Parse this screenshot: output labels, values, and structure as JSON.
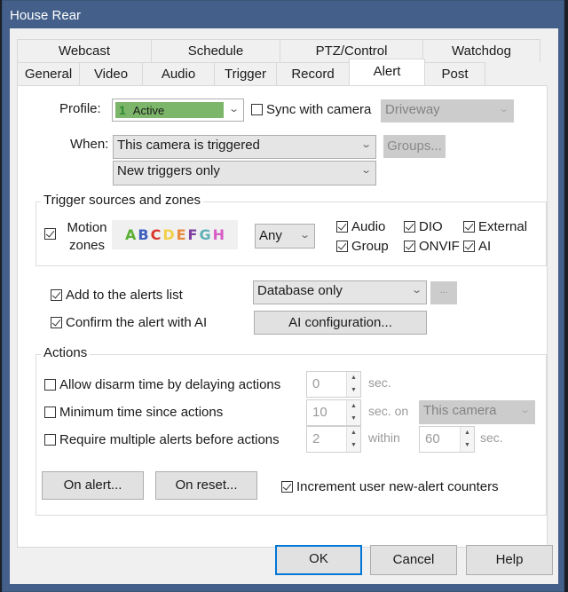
{
  "window": {
    "title": "House Rear"
  },
  "tabs": {
    "row1": [
      "Webcast",
      "Schedule",
      "PTZ/Control",
      "Watchdog"
    ],
    "row2": [
      "General",
      "Video",
      "Audio",
      "Trigger",
      "Record",
      "Alert",
      "Post"
    ],
    "active": "Alert"
  },
  "profile": {
    "label": "Profile:",
    "number": "1",
    "value": "Active",
    "color": "#7cb66a",
    "sync_label": "Sync with camera",
    "sync_checked": false,
    "sync_camera": "Driveway"
  },
  "when": {
    "label": "When:",
    "trigger_value": "This camera is triggered",
    "groups_button": "Groups...",
    "mode_value": "New triggers only"
  },
  "trigger_sources": {
    "title": "Trigger sources and zones",
    "motion_zones_label_1": "Motion",
    "motion_zones_label_2": "zones",
    "motion_zones_checked": true,
    "zones": [
      {
        "letter": "A",
        "color": "#5cb036"
      },
      {
        "letter": "B",
        "color": "#3a5fbf"
      },
      {
        "letter": "C",
        "color": "#d9362b"
      },
      {
        "letter": "D",
        "color": "#f2cf4a"
      },
      {
        "letter": "E",
        "color": "#e88a3a"
      },
      {
        "letter": "F",
        "color": "#7d3fa0"
      },
      {
        "letter": "G",
        "color": "#5fb0b8"
      },
      {
        "letter": "H",
        "color": "#d65cc6"
      }
    ],
    "zone_mode": "Any",
    "sources": [
      {
        "label": "Audio",
        "checked": true
      },
      {
        "label": "DIO",
        "checked": true
      },
      {
        "label": "External",
        "checked": true
      },
      {
        "label": "Group",
        "checked": true
      },
      {
        "label": "ONVIF",
        "checked": true
      },
      {
        "label": "AI",
        "checked": true
      }
    ]
  },
  "alerts": {
    "add_to_list_label": "Add to the alerts list",
    "add_to_list_checked": true,
    "list_mode": "Database only",
    "more_button": "...",
    "confirm_ai_label": "Confirm the alert with AI",
    "confirm_ai_checked": true,
    "ai_config_button": "AI configuration..."
  },
  "actions": {
    "title": "Actions",
    "disarm_label": "Allow disarm time by delaying actions",
    "disarm_checked": false,
    "disarm_value": "0",
    "disarm_unit": "sec.",
    "min_time_label": "Minimum time since actions",
    "min_time_checked": false,
    "min_time_value": "10",
    "min_time_unit": "sec. on",
    "min_time_scope": "This camera",
    "multiple_label": "Require multiple alerts before actions",
    "multiple_checked": false,
    "multiple_count": "2",
    "multiple_within": "within",
    "multiple_window": "60",
    "multiple_unit": "sec.",
    "on_alert_button": "On alert...",
    "on_reset_button": "On reset...",
    "increment_label": "Increment user new-alert counters",
    "increment_checked": true
  },
  "footer": {
    "ok": "OK",
    "cancel": "Cancel",
    "help": "Help"
  }
}
